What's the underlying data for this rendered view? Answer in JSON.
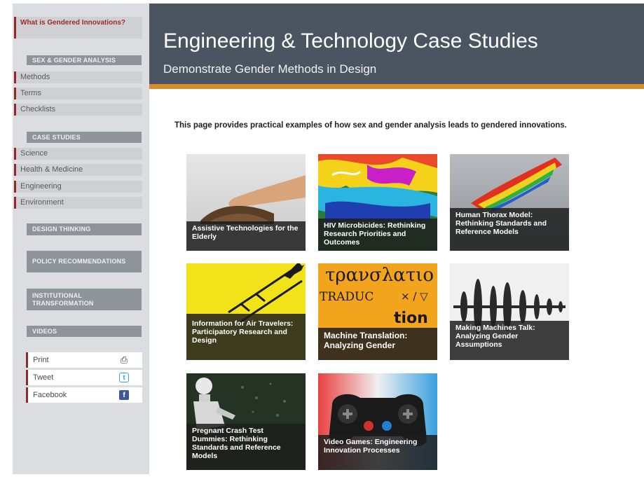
{
  "sidebar": {
    "top_link": "What is Gendered Innovations?",
    "sections": [
      {
        "header": "SEX & GENDER ANALYSIS",
        "items": [
          "Methods",
          "Terms",
          "Checklists"
        ]
      },
      {
        "header": "CASE STUDIES",
        "items": [
          "Science",
          "Health & Medicine",
          "Engineering",
          "Environment"
        ]
      },
      {
        "header": "DESIGN THINKING",
        "items": []
      },
      {
        "header": "POLICY RECOMMENDATIONS",
        "items": []
      },
      {
        "header": "INSTITUTIONAL TRANSFORMATION",
        "items": []
      },
      {
        "header": "VIDEOS",
        "items": []
      }
    ],
    "share": [
      {
        "label": "Print",
        "icon": "print-icon"
      },
      {
        "label": "Tweet",
        "icon": "twitter-icon"
      },
      {
        "label": "Facebook",
        "icon": "facebook-icon"
      }
    ]
  },
  "banner": {
    "title": "Engineering & Technology Case Studies",
    "subtitle": "Demonstrate Gender Methods in Design"
  },
  "intro": "This page provides practical examples of how sex and gender analysis leads to gendered innovations.",
  "tiles": [
    {
      "title": "Assistive Technologies for the Elderly"
    },
    {
      "title": "HIV Microbicides: Rethinking Research Priorities and Outcomes"
    },
    {
      "title": "Human Thorax Model: Rethinking Standards and Reference Models"
    },
    {
      "title": "Information for Air Travelers: Participatory Research and Design"
    },
    {
      "title": "Machine Translation: Analyzing Gender"
    },
    {
      "title": "Making Machines Talk: Analyzing Gender Assumptions"
    },
    {
      "title": "Pregnant Crash Test Dummies: Rethinking Standards and Reference Models"
    },
    {
      "title": "Video Games: Engineering Innovation Processes"
    }
  ],
  "tile_art": {
    "translation_words": [
      "τρανσλατιο",
      "TRADUC",
      "× / ▽",
      "tion"
    ]
  },
  "colors": {
    "banner": "#4b5561",
    "accent_stripe": "#d98a2a",
    "sidebar": "#dcdde0",
    "sidebar_header": "#8f949b",
    "link_marker": "#8e2a2a"
  }
}
